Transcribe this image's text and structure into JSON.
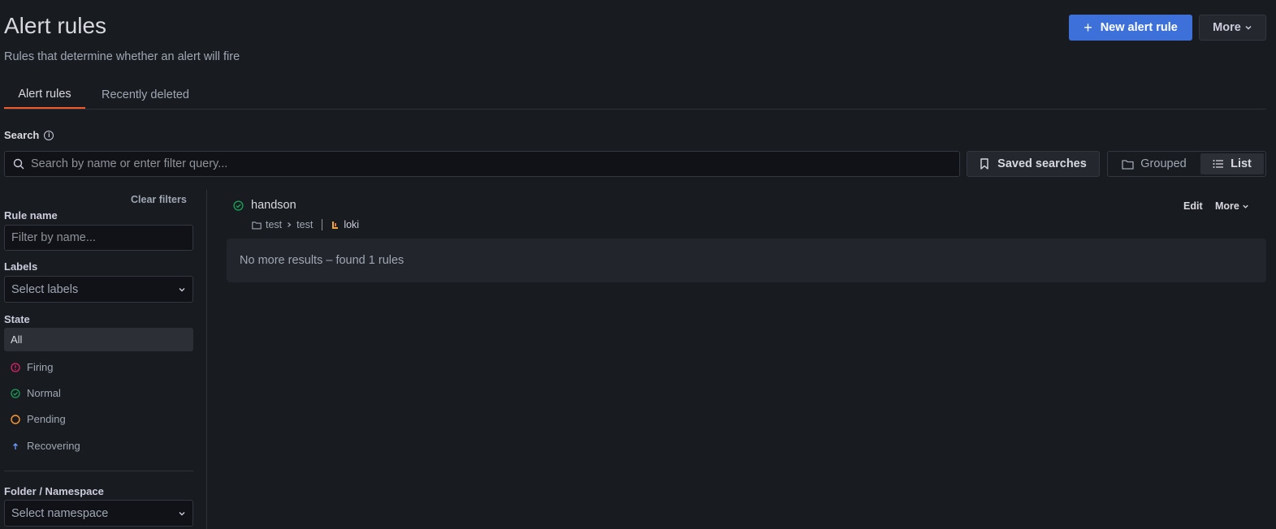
{
  "header": {
    "title": "Alert rules",
    "subtitle": "Rules that determine whether an alert will fire",
    "new_rule_label": "New alert rule",
    "more_label": "More"
  },
  "tabs": [
    {
      "label": "Alert rules",
      "active": true
    },
    {
      "label": "Recently deleted",
      "active": false
    }
  ],
  "search": {
    "label": "Search",
    "placeholder": "Search by name or enter filter query...",
    "value": "",
    "saved_searches_label": "Saved searches",
    "view_modes": {
      "grouped": "Grouped",
      "list": "List",
      "selected": "list"
    }
  },
  "filters": {
    "clear_label": "Clear filters",
    "rule_name": {
      "label": "Rule name",
      "placeholder": "Filter by name..."
    },
    "labels": {
      "label": "Labels",
      "placeholder": "Select labels"
    },
    "state": {
      "label": "State",
      "options": [
        {
          "label": "All",
          "icon": "none",
          "active": true
        },
        {
          "label": "Firing",
          "icon": "exclamation-circle-icon",
          "color": "#e0226e"
        },
        {
          "label": "Normal",
          "icon": "check-circle-icon",
          "color": "#1a9f5a"
        },
        {
          "label": "Pending",
          "icon": "circle-icon",
          "color": "#ff9830"
        },
        {
          "label": "Recovering",
          "icon": "arrow-up-icon",
          "color": "#6e9fff"
        }
      ]
    },
    "namespace": {
      "label": "Folder / Namespace",
      "placeholder": "Select namespace"
    }
  },
  "rules": [
    {
      "name": "handson",
      "status_icon": "check-circle-icon",
      "folder": "test",
      "group": "test",
      "datasource": "loki",
      "edit_label": "Edit",
      "more_label": "More"
    }
  ],
  "results_message": "No more results – found 1 rules",
  "colors": {
    "accent": "#3d71d9",
    "tab_indicator": "#f05a28",
    "normal": "#1a9f5a",
    "firing": "#e0226e",
    "pending": "#ff9830",
    "recovering": "#6e9fff"
  }
}
